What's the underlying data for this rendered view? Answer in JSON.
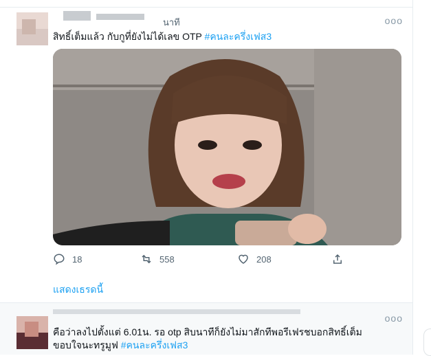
{
  "tweet1": {
    "handle_suffix": "นาที",
    "more": "ooo",
    "text": "สิทธิ์เต็มแล้ว กับกูที่ยังไม่ได้เลข OTP ",
    "hashtag": "#คนละครึ่งเฟส3",
    "replies": "18",
    "retweets": "558",
    "likes": "208",
    "show_thread": "แสดงเธรดนี้"
  },
  "tweet2": {
    "more": "ooo",
    "line1": "คือว่าลงไปตั้งแต่ 6.01น. รอ otp สิบนาทีก็ยังไม่มาสักทีพอรีเฟรชบอกสิทธิ์เต็ม",
    "line2": "ขอบใจนะทรูมูฟ ",
    "hashtag": "#คนละครึ่งเฟส3"
  },
  "icons": {
    "reply": "reply-icon",
    "retweet": "retweet-icon",
    "like": "heart-icon",
    "share": "share-icon"
  },
  "colors": {
    "accent": "#1da1f2",
    "muted": "#536471",
    "border": "#e6ecf0"
  }
}
